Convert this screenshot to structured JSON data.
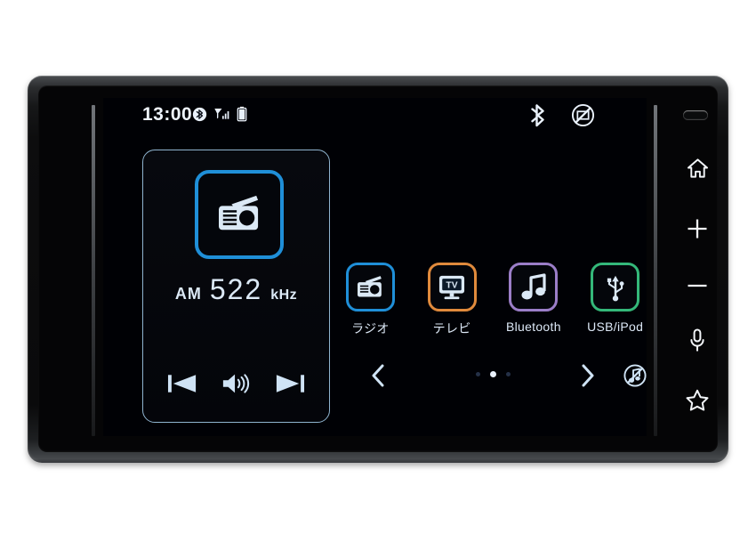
{
  "device": {
    "name": "car-audio-head-unit",
    "accent_blue": "#1f8fd8",
    "text_color": "#dde9f7",
    "screen_bg": "#000105"
  },
  "status_bar": {
    "clock": "13:00",
    "left_icons": [
      {
        "name": "bluetooth-connected-icon",
        "label": "Bluetooth"
      },
      {
        "name": "signal-strength-icon",
        "label": "Signal"
      },
      {
        "name": "battery-icon",
        "label": "Battery"
      }
    ],
    "right_icons": [
      {
        "name": "bluetooth-icon",
        "label": "Bluetooth"
      },
      {
        "name": "no-disc-icon",
        "label": "No Disc"
      }
    ]
  },
  "now_playing": {
    "source_icon": "radio-icon",
    "band": "AM",
    "frequency": "522",
    "unit": "kHz",
    "controls": [
      {
        "name": "previous-track-button",
        "label": "Previous"
      },
      {
        "name": "volume-button",
        "label": "Volume"
      },
      {
        "name": "next-track-button",
        "label": "Next"
      }
    ]
  },
  "sources": [
    {
      "key": "radio",
      "label": "ラジオ",
      "icon": "radio-icon",
      "color": "#1f8fd8"
    },
    {
      "key": "tv",
      "label": "テレビ",
      "icon": "tv-icon",
      "color": "#e08a3c"
    },
    {
      "key": "bluetooth",
      "label": "Bluetooth",
      "icon": "music-note-icon",
      "color": "#9b7ec8"
    },
    {
      "key": "usb_ipod",
      "label": "USB/iPod",
      "icon": "usb-icon",
      "color": "#34b87a"
    }
  ],
  "pager": {
    "prev_label": "<",
    "next_label": ">",
    "page_count": 3,
    "current_page": 2,
    "mute_button": {
      "name": "mute-audio-button",
      "label": "Mute"
    }
  },
  "hard_keys": [
    {
      "name": "proximity-sensor",
      "label": "Sensor"
    },
    {
      "name": "home-button",
      "label": "Home"
    },
    {
      "name": "volume-up-button",
      "label": "Volume Up"
    },
    {
      "name": "volume-down-button",
      "label": "Volume Down"
    },
    {
      "name": "voice-command-button",
      "label": "Voice"
    },
    {
      "name": "favorite-button",
      "label": "Favorite"
    }
  ]
}
